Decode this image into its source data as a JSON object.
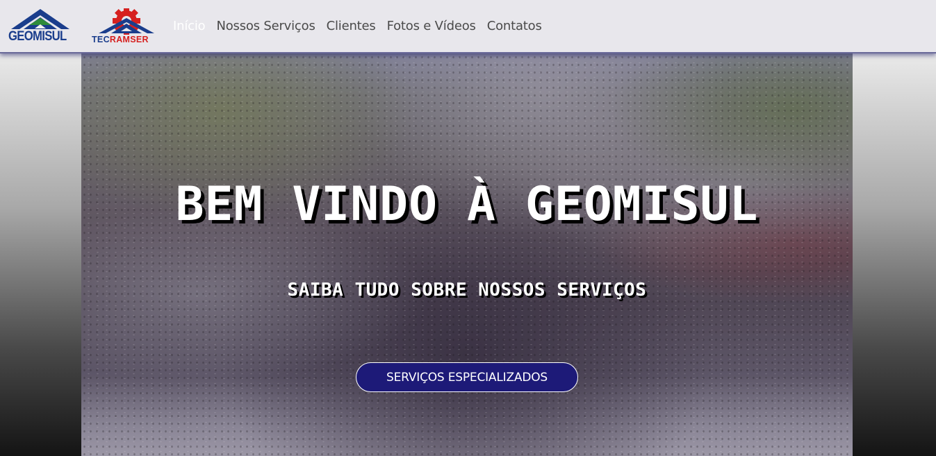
{
  "navbar": {
    "logos": [
      {
        "text": "GEOMISUL",
        "icon": "geomisul-roof-logo",
        "color": "#1a3d8c"
      },
      {
        "text_primary": "TEC",
        "text_secondary": "RAMSER",
        "icon": "tecramser-gear-logo",
        "colors": [
          "#1a3d8c",
          "#d6201f"
        ]
      }
    ],
    "links": [
      {
        "label": "Início",
        "active": true
      },
      {
        "label": "Nossos Serviços",
        "active": false
      },
      {
        "label": "Clientes",
        "active": false
      },
      {
        "label": "Fotos e Vídeos",
        "active": false
      },
      {
        "label": "Contatos",
        "active": false
      }
    ],
    "background": "#e8e7ec",
    "active_color": "#ffffff",
    "link_color": "#4a4a4a"
  },
  "hero": {
    "title": "BEM VINDO À GEOMISUL",
    "subtitle": "SAIBA TUDO SOBRE NOSSOS SERVIÇOS",
    "button_label": "SERVIÇOS ESPECIALIZADOS",
    "button_color": "#1d1a78",
    "background_image": "rock-blasting-explosion-photo"
  }
}
